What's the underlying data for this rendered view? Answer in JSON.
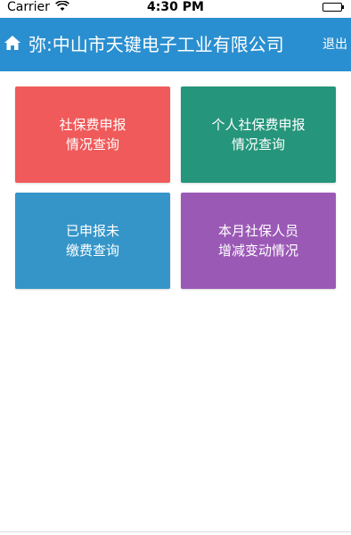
{
  "status_bar": {
    "carrier": "Carrier",
    "time": "4:30 PM",
    "wifi_icon": "wifi-icon",
    "battery_icon": "battery-icon"
  },
  "nav": {
    "home_icon": "home-icon",
    "title": "欢迎你:中山市天键电子工业有限公司",
    "title_visible": "弥:中山市天键电子工业有限公司",
    "logout": "退出",
    "bg_color": "#2a8fd0"
  },
  "tiles": [
    {
      "line1": "社保费申报",
      "line2": "情况查询",
      "color": "#f05a5a"
    },
    {
      "line1": "个人社保费申报",
      "line2": "情况查询",
      "color": "#25957b"
    },
    {
      "line1": "已申报未",
      "line2": "缴费查询",
      "color": "#3595c8"
    },
    {
      "line1": "本月社保人员",
      "line2": "增减变动情况",
      "color": "#9b59b6"
    }
  ]
}
